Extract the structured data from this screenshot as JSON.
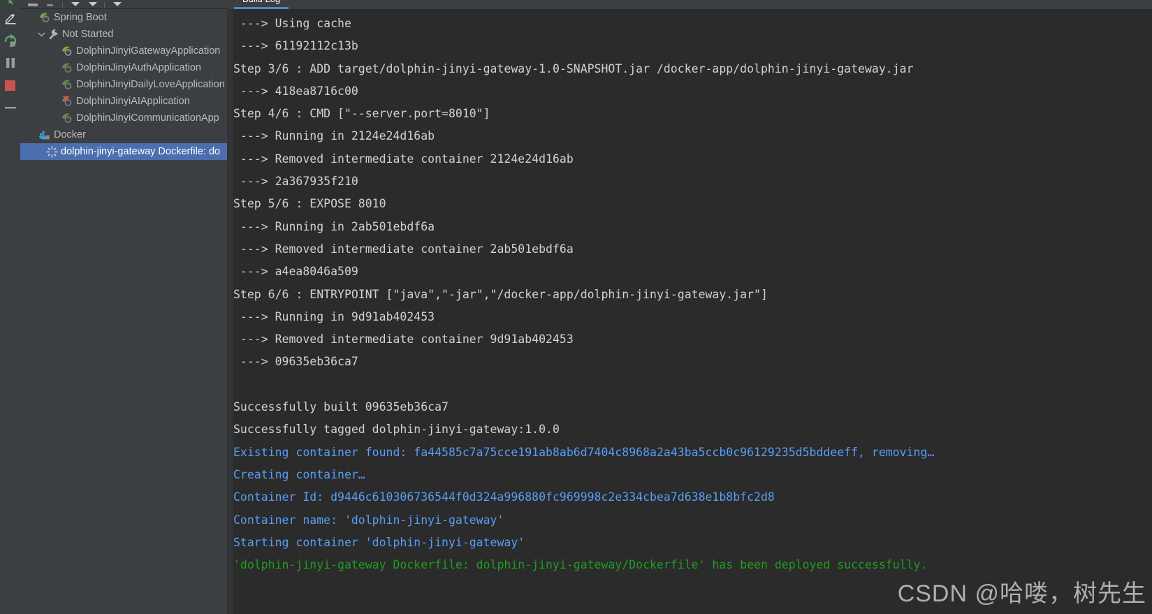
{
  "window": {
    "background": "#3c3f41",
    "console_background": "#2b2b2b",
    "selection_color": "#4b6eaf"
  },
  "run_toolbar": {
    "buttons": [
      {
        "name": "rerun-icon",
        "label": "Rerun",
        "color": "#59a869"
      },
      {
        "name": "edit-configuration-icon",
        "label": "Edit Configuration",
        "color": "#afb1b3"
      },
      {
        "name": "rerun-failed-icon",
        "label": "Rerun",
        "color": "#59a869"
      },
      {
        "name": "pause-icon",
        "label": "Pause Output",
        "color": "#9a9d9f"
      },
      {
        "name": "stop-icon",
        "label": "Stop",
        "color": "#c75450"
      },
      {
        "name": "minimize-icon",
        "label": "Minimize",
        "color": "#9a9d9f"
      }
    ]
  },
  "top_toolbar": {
    "items": [
      "toolbar-button",
      "toolbar-button",
      "separator",
      "dropdown-caret",
      "dropdown-caret",
      "separator",
      "dropdown-caret"
    ]
  },
  "tabs": [
    {
      "label": "Build Log",
      "active": true,
      "accent": "#4a88c7"
    }
  ],
  "tree": {
    "nodes": [
      {
        "label": "Spring Boot",
        "icon": "spring-boot-icon",
        "indent": 0,
        "twisty": "",
        "selected": false
      },
      {
        "label": "Not Started",
        "icon": "wrench-icon",
        "indent": 1,
        "twisty": "expanded",
        "selected": false
      },
      {
        "label": "DolphinJinyiGatewayApplication",
        "icon": "spring-boot-run-icon",
        "indent": 2,
        "twisty": "",
        "selected": false
      },
      {
        "label": "DolphinJinyiAuthApplication",
        "icon": "spring-boot-run-icon",
        "indent": 2,
        "twisty": "",
        "selected": false
      },
      {
        "label": "DolphinJinyiDailyLoveApplication",
        "icon": "spring-boot-run-icon",
        "indent": 2,
        "twisty": "",
        "selected": false
      },
      {
        "label": "DolphinJinyiAIApplication",
        "icon": "spring-boot-error-icon",
        "indent": 2,
        "twisty": "",
        "selected": false
      },
      {
        "label": "DolphinJinyiCommunicationApp",
        "icon": "spring-boot-run-icon",
        "indent": 2,
        "twisty": "",
        "selected": false
      },
      {
        "label": "Docker",
        "icon": "docker-icon",
        "indent": 0,
        "twisty": "",
        "selected": false
      },
      {
        "label": "dolphin-jinyi-gateway Dockerfile: do",
        "icon": "loading-spinner-icon",
        "indent": 1,
        "twisty": "",
        "selected": true
      }
    ]
  },
  "console": {
    "lines": [
      {
        "text": " ---> Using cache",
        "color": "#cfd2d4"
      },
      {
        "text": " ---> 61192112c13b",
        "color": "#cfd2d4"
      },
      {
        "text": "Step 3/6 : ADD target/dolphin-jinyi-gateway-1.0-SNAPSHOT.jar /docker-app/dolphin-jinyi-gateway.jar",
        "color": "#cfd2d4"
      },
      {
        "text": " ---> 418ea8716c00",
        "color": "#cfd2d4"
      },
      {
        "text": "Step 4/6 : CMD [\"--server.port=8010\"]",
        "color": "#cfd2d4"
      },
      {
        "text": " ---> Running in 2124e24d16ab",
        "color": "#cfd2d4"
      },
      {
        "text": " ---> Removed intermediate container 2124e24d16ab",
        "color": "#cfd2d4"
      },
      {
        "text": " ---> 2a367935f210",
        "color": "#cfd2d4"
      },
      {
        "text": "Step 5/6 : EXPOSE 8010",
        "color": "#cfd2d4"
      },
      {
        "text": " ---> Running in 2ab501ebdf6a",
        "color": "#cfd2d4"
      },
      {
        "text": " ---> Removed intermediate container 2ab501ebdf6a",
        "color": "#cfd2d4"
      },
      {
        "text": " ---> a4ea8046a509",
        "color": "#cfd2d4"
      },
      {
        "text": "Step 6/6 : ENTRYPOINT [\"java\",\"-jar\",\"/docker-app/dolphin-jinyi-gateway.jar\"]",
        "color": "#cfd2d4"
      },
      {
        "text": " ---> Running in 9d91ab402453",
        "color": "#cfd2d4"
      },
      {
        "text": " ---> Removed intermediate container 9d91ab402453",
        "color": "#cfd2d4"
      },
      {
        "text": " ---> 09635eb36ca7",
        "color": "#cfd2d4"
      },
      {
        "text": "",
        "color": "#cfd2d4"
      },
      {
        "text": "Successfully built 09635eb36ca7",
        "color": "#cfd2d4"
      },
      {
        "text": "Successfully tagged dolphin-jinyi-gateway:1.0.0",
        "color": "#cfd2d4"
      },
      {
        "text": "Existing container found: fa44585c7a75cce191ab8ab6d7404c8968a2a43ba5ccb0c96129235d5bddeeff, removing…",
        "color": "#589df6"
      },
      {
        "text": "Creating container…",
        "color": "#589df6"
      },
      {
        "text": "Container Id: d9446c610306736544f0d324a996880fc969998c2e334cbea7d638e1b8bfc2d8",
        "color": "#589df6"
      },
      {
        "text": "Container name: 'dolphin-jinyi-gateway'",
        "color": "#589df6"
      },
      {
        "text": "Starting container 'dolphin-jinyi-gateway'",
        "color": "#589df6"
      },
      {
        "text": "'dolphin-jinyi-gateway Dockerfile: dolphin-jinyi-gateway/Dockerfile' has been deployed successfully.",
        "color": "#1f9d1f"
      }
    ]
  },
  "watermark": {
    "text": "CSDN @哈喽，树先生"
  }
}
